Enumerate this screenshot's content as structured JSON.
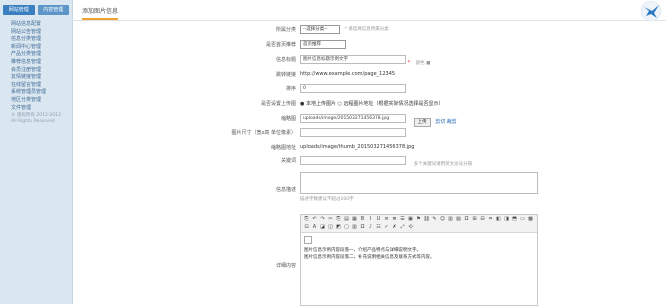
{
  "sidebar": {
    "tabs": [
      {
        "label": "网站管理"
      },
      {
        "label": "内容管理"
      }
    ],
    "items": [
      {
        "label": "网站信息配置"
      },
      {
        "label": "网站公告管理"
      },
      {
        "label": "信息分类管理"
      },
      {
        "label": "新闻中心管理"
      },
      {
        "label": "产品分类管理"
      },
      {
        "label": "推荐信息管理"
      },
      {
        "label": "会员注册管理"
      },
      {
        "label": "友情链接管理"
      },
      {
        "label": "在线留言管理"
      },
      {
        "label": "系统管理员管理"
      },
      {
        "label": "地区分类管理"
      },
      {
        "label": "文件管理"
      }
    ],
    "footer": [
      "© 版权所有 2012-2013",
      "All Rights Reserved"
    ]
  },
  "header": {
    "current_tab": "添加图片信息"
  },
  "form": {
    "category": {
      "label": "所属分类",
      "value": "--选择分类--",
      "hint": "* 请选择信息所属分类"
    },
    "recommend": {
      "label": "是否首页推荐",
      "value": "首页推荐"
    },
    "title": {
      "label": "信息标题",
      "value": "图片信息标题示例文字",
      "extra": "颜色 ■"
    },
    "link": {
      "label": "跳转链接",
      "value": "http://www.example.com/page_12345"
    },
    "order": {
      "label": "排序",
      "value": "0"
    },
    "pic_mode": {
      "label": "是否设置上传图",
      "value": "● 本地上传图片  ○ 远程图片地址（根据实际情况选择是否显示）"
    },
    "pic_path": {
      "label": "缩略图",
      "value": "uploads/image/201503271456378.jpg",
      "upload": "上传",
      "hint": "剪切 裁剪"
    },
    "pic_size": {
      "label": "图片尺寸（宽x高 单位像素）",
      "value": ""
    },
    "thumb": {
      "label": "缩略图地址",
      "value": "uploads/image/thumb_201503271456378.jpg"
    },
    "keywords": {
      "label": "关键词",
      "value": "",
      "hint": "多个关键词请用英文逗号分隔"
    },
    "description": {
      "label": "信息描述",
      "value": "",
      "hint": "描述字数建议不超过200字"
    },
    "content": {
      "label": "详细内容",
      "toolbar": [
        "⎘",
        "↶",
        "↷",
        "✂",
        "⎘",
        "▤",
        "▦",
        "B",
        "I",
        "U",
        "≡",
        "≣",
        "☰",
        "▣",
        "⚑",
        "⛓",
        "✎",
        "☺",
        "▥",
        "▧",
        "Ω",
        "⊞",
        "⊟",
        "⌗",
        "◧",
        "◨",
        "⬒",
        "▭",
        "▩",
        "⊡",
        "A",
        "◪",
        "◫",
        "◩",
        "▢",
        "▥",
        "Ω",
        "♪",
        "☷",
        "✓",
        "✗",
        "⤢",
        "⟲"
      ],
      "lines": [
        "图片信息示例内容段落一，介绍产品特点与详细说明文字。",
        "图片信息示例内容段落二，补充说明相关信息及联系方式等内容。"
      ]
    }
  },
  "logo_icon": "bird-icon"
}
